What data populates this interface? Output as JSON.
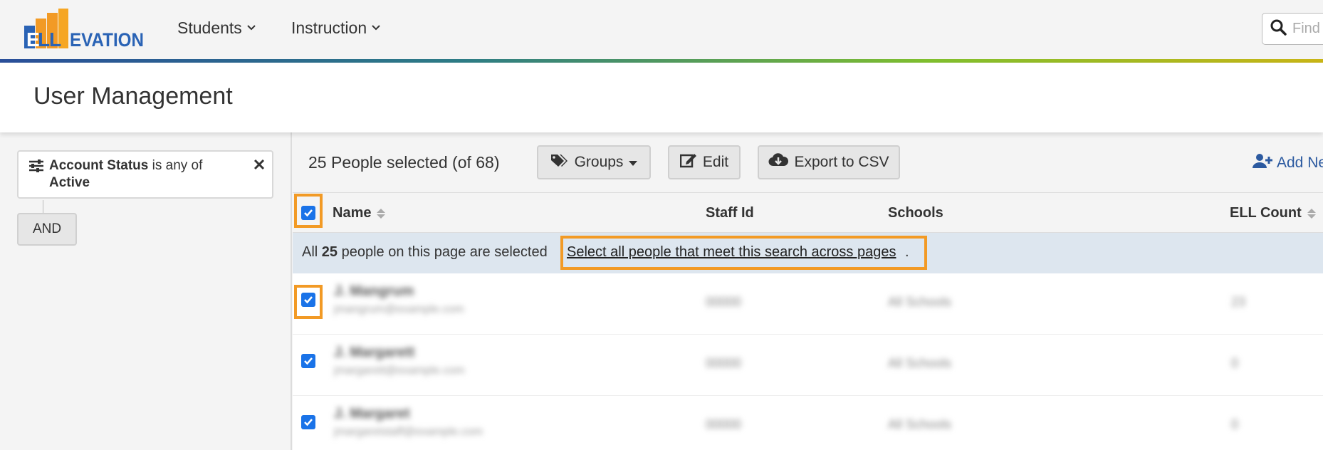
{
  "nav": {
    "logo_text": "ELLEVATION",
    "students_label": "Students",
    "instruction_label": "Instruction",
    "search_placeholder": "Find"
  },
  "header": {
    "title": "User Management"
  },
  "filter": {
    "field": "Account Status",
    "operator": "is any of",
    "value": "Active",
    "and_label": "AND"
  },
  "toolbar": {
    "selection_text": "25 People selected (of 68)",
    "groups_label": "Groups",
    "edit_label": "Edit",
    "export_label": "Export to CSV",
    "add_new_label": "Add Ne"
  },
  "table": {
    "columns": {
      "name": "Name",
      "staff_id": "Staff Id",
      "schools": "Schools",
      "ell_count": "ELL Count"
    },
    "rows": [
      {
        "name": "J. Mangrum",
        "email": "jmangrum@example.com",
        "staff_id": "00000",
        "schools": "All Schools",
        "ell_count": "23"
      },
      {
        "name": "J. Margarett",
        "email": "jmargarett@example.com",
        "staff_id": "00000",
        "schools": "All Schools",
        "ell_count": "0"
      },
      {
        "name": "J. Margaret",
        "email": "jmargaretstaff@example.com",
        "staff_id": "00000",
        "schools": "All Schools",
        "ell_count": "0"
      }
    ]
  },
  "banner": {
    "prefix": "All",
    "count": "25",
    "suffix": "people on this page are selected",
    "link_text": "Select all people that meet this search across pages",
    "trailing": "."
  },
  "colors": {
    "accent": "#f29a25",
    "checkbox": "#1a73e8",
    "link": "#2c5aa0",
    "banner_bg": "#dde6ef"
  }
}
